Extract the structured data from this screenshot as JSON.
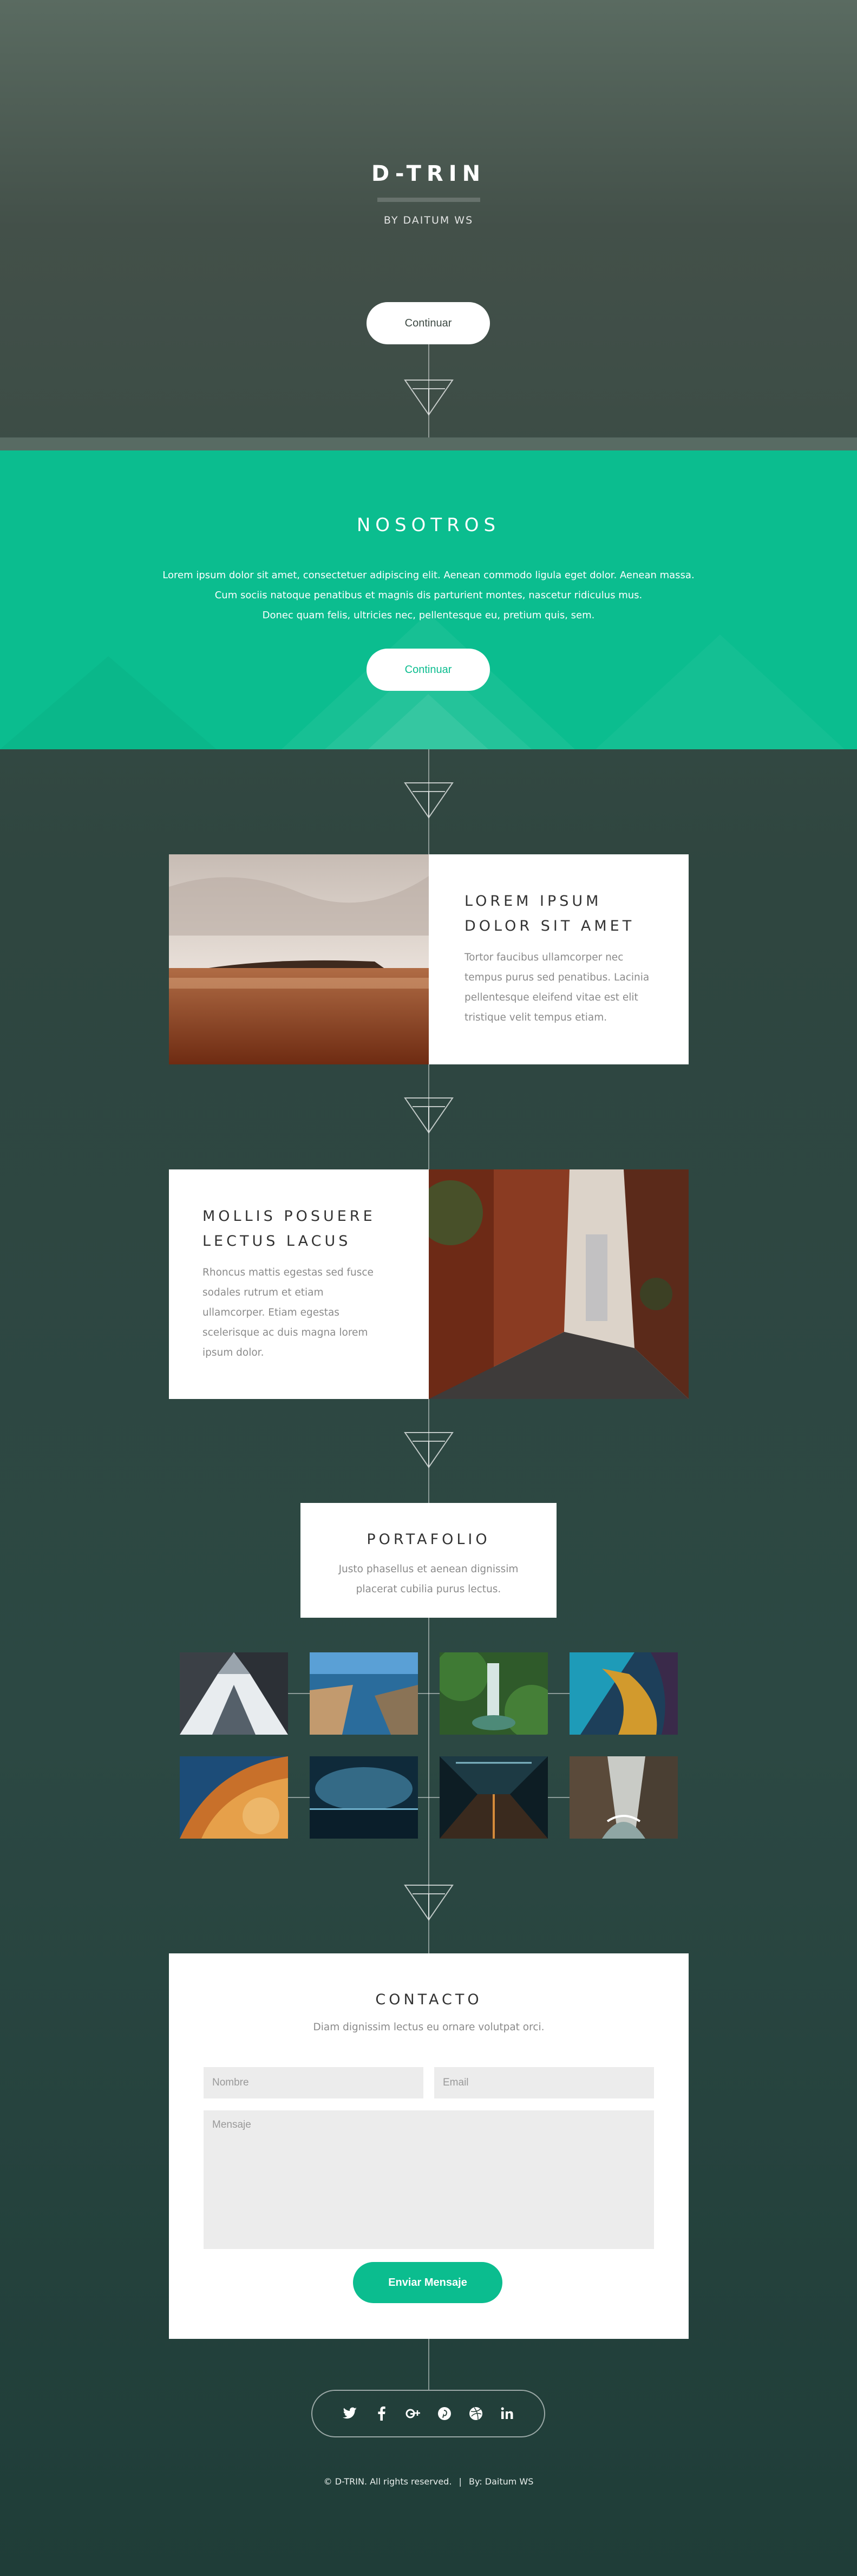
{
  "hero": {
    "title": "D-TRIN",
    "subtitle": "BY DAITUM WS",
    "button_label": "Continuar"
  },
  "nosotros": {
    "title": "NOSOTROS",
    "lines": [
      "Lorem ipsum dolor sit amet, consectetuer adipiscing elit. Aenean commodo ligula eget dolor. Aenean massa.",
      "Cum sociis natoque penatibus et magnis dis parturient montes, nascetur ridiculus mus.",
      "Donec quam felis, ultricies nec, pellentesque eu, pretium quis, sem."
    ],
    "button_label": "Continuar"
  },
  "features": [
    {
      "title_lines": [
        "LOREM IPSUM",
        "DOLOR SIT AMET"
      ],
      "text_lines": [
        "Tortor faucibus ullamcorper nec",
        "tempus purus sed penatibus. Lacinia",
        "pellentesque eleifend vitae est elit",
        "tristique velit tempus etiam."
      ]
    },
    {
      "title_lines": [
        "MOLLIS POSUERE",
        "LECTUS LACUS"
      ],
      "text_lines": [
        "Rhoncus mattis egestas sed fusce",
        "sodales rutrum et etiam",
        "ullamcorper. Etiam egestas",
        "scelerisque ac duis magna lorem",
        "ipsum dolor."
      ]
    }
  ],
  "portfolio": {
    "title": "PORTAFOLIO",
    "text_lines": [
      "Justo phasellus et aenean dignissim",
      "placerat cubilia purus lectus."
    ]
  },
  "contact": {
    "title": "CONTACTO",
    "subtitle": "Diam dignissim lectus eu ornare volutpat orci.",
    "name_placeholder": "Nombre",
    "email_placeholder": "Email",
    "message_placeholder": "Mensaje",
    "send_label": "Enviar Mensaje"
  },
  "social": [
    "twitter-icon",
    "facebook-icon",
    "google-plus-icon",
    "pinterest-icon",
    "dribbble-icon",
    "linkedin-icon"
  ],
  "footer": {
    "copyright": "© D-TRIN. All rights reserved.",
    "separator": "|",
    "credit": "By: Daitum WS"
  },
  "colors": {
    "accent": "#0bbd8f",
    "hero_top": "#5a6b61",
    "background_bottom": "#1f3d38"
  }
}
